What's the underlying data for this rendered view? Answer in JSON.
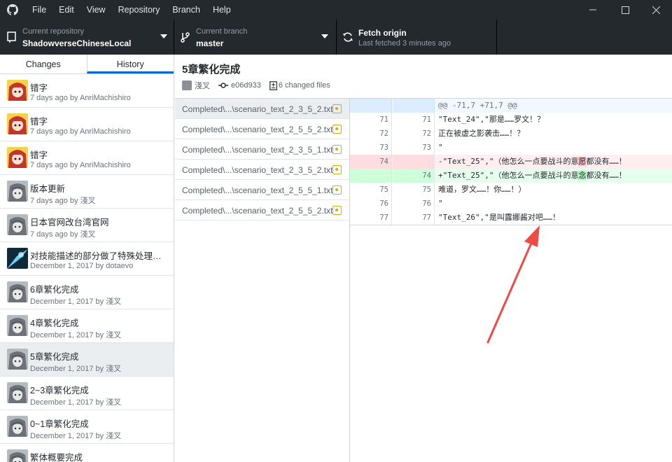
{
  "menu": [
    "File",
    "Edit",
    "View",
    "Repository",
    "Branch",
    "Help"
  ],
  "toolbar": {
    "repo_label": "Current repository",
    "repo_value": "ShadowverseChineseLocal",
    "branch_label": "Current branch",
    "branch_value": "master",
    "fetch_label": "Fetch origin",
    "fetch_sub": "Last fetched 3 minutes ago"
  },
  "tabs": {
    "changes": "Changes",
    "history": "History"
  },
  "commits": [
    {
      "summary": "错字",
      "meta": "7 days ago by AnriMachishiro",
      "avatar": "red-hair"
    },
    {
      "summary": "错字",
      "meta": "7 days ago by AnriMachishiro",
      "avatar": "red-hair"
    },
    {
      "summary": "错字",
      "meta": "7 days ago by AnriMachishiro",
      "avatar": "red-hair"
    },
    {
      "summary": "版本更新",
      "meta": "7 days ago by 淺叉",
      "avatar": "grey"
    },
    {
      "summary": "日本官网改台湾官网",
      "meta": "7 days ago by 淺叉",
      "avatar": "grey"
    },
    {
      "summary": "对技能描述的部分做了特殊处理，不.",
      "meta": "December 1, 2017 by dotaevo",
      "avatar": "blue"
    },
    {
      "summary": "6章繁化完成",
      "meta": "December 1, 2017 by 淺叉",
      "avatar": "grey"
    },
    {
      "summary": "4章繁化完成",
      "meta": "December 1, 2017 by 淺叉",
      "avatar": "grey"
    },
    {
      "summary": "5章繁化完成",
      "meta": "December 1, 2017 by 淺叉",
      "avatar": "grey"
    },
    {
      "summary": "2~3章繁化完成",
      "meta": "December 1, 2017 by 淺叉",
      "avatar": "grey"
    },
    {
      "summary": "0~1章繁化完成",
      "meta": "December 1, 2017 by 淺叉",
      "avatar": "grey"
    },
    {
      "summary": "繁体概要完成",
      "meta": "",
      "avatar": "grey"
    }
  ],
  "selected_commit": {
    "title": "5章繁化完成",
    "author": "淺叉",
    "sha": "e06d933",
    "changed": "6 changed files"
  },
  "files": [
    "Completed\\...\\scenario_text_2_3_5_2.txt",
    "Completed\\...\\scenario_text_2_5_5_2.txt",
    "Completed\\...\\scenario_text_2_3_5_1.txt",
    "Completed\\...\\scenario_text_2_3_5_2.txt",
    "Completed\\...\\scenario_text_2_5_5_1.txt",
    "Completed\\...\\scenario_text_2_5_5_2.txt"
  ],
  "diff": {
    "hunk": "@@ -71,7 +71,7 @@",
    "lines": [
      {
        "old": "71",
        "new": "71",
        "type": "ctx",
        "text": " \"Text_24\",\"那是……罗文！？"
      },
      {
        "old": "72",
        "new": "72",
        "type": "ctx",
        "text": " 正在被虚之影袭击……！？"
      },
      {
        "old": "73",
        "new": "73",
        "type": "ctx",
        "text": " \""
      },
      {
        "old": "74",
        "new": "",
        "type": "del",
        "pre": "-\"Text_25\",\"（他怎么一点要战斗的意",
        "hl": "愿",
        "post": "都没有……！"
      },
      {
        "old": "",
        "new": "74",
        "type": "add",
        "pre": "+\"Text_25\",\"（他怎么一点要战斗的意",
        "hl": "念",
        "post": "都没有……！"
      },
      {
        "old": "75",
        "new": "75",
        "type": "ctx",
        "text": " 难道，罗文……！你……！）"
      },
      {
        "old": "76",
        "new": "76",
        "type": "ctx",
        "text": " \""
      },
      {
        "old": "77",
        "new": "77",
        "type": "ctx",
        "text": " \"Text_26\",\"是叫露娜酱对吧……！"
      }
    ]
  },
  "colors": {
    "accent": "#0366d6",
    "annotation_arrow": "#f04a44",
    "modified": "#dbab09"
  }
}
